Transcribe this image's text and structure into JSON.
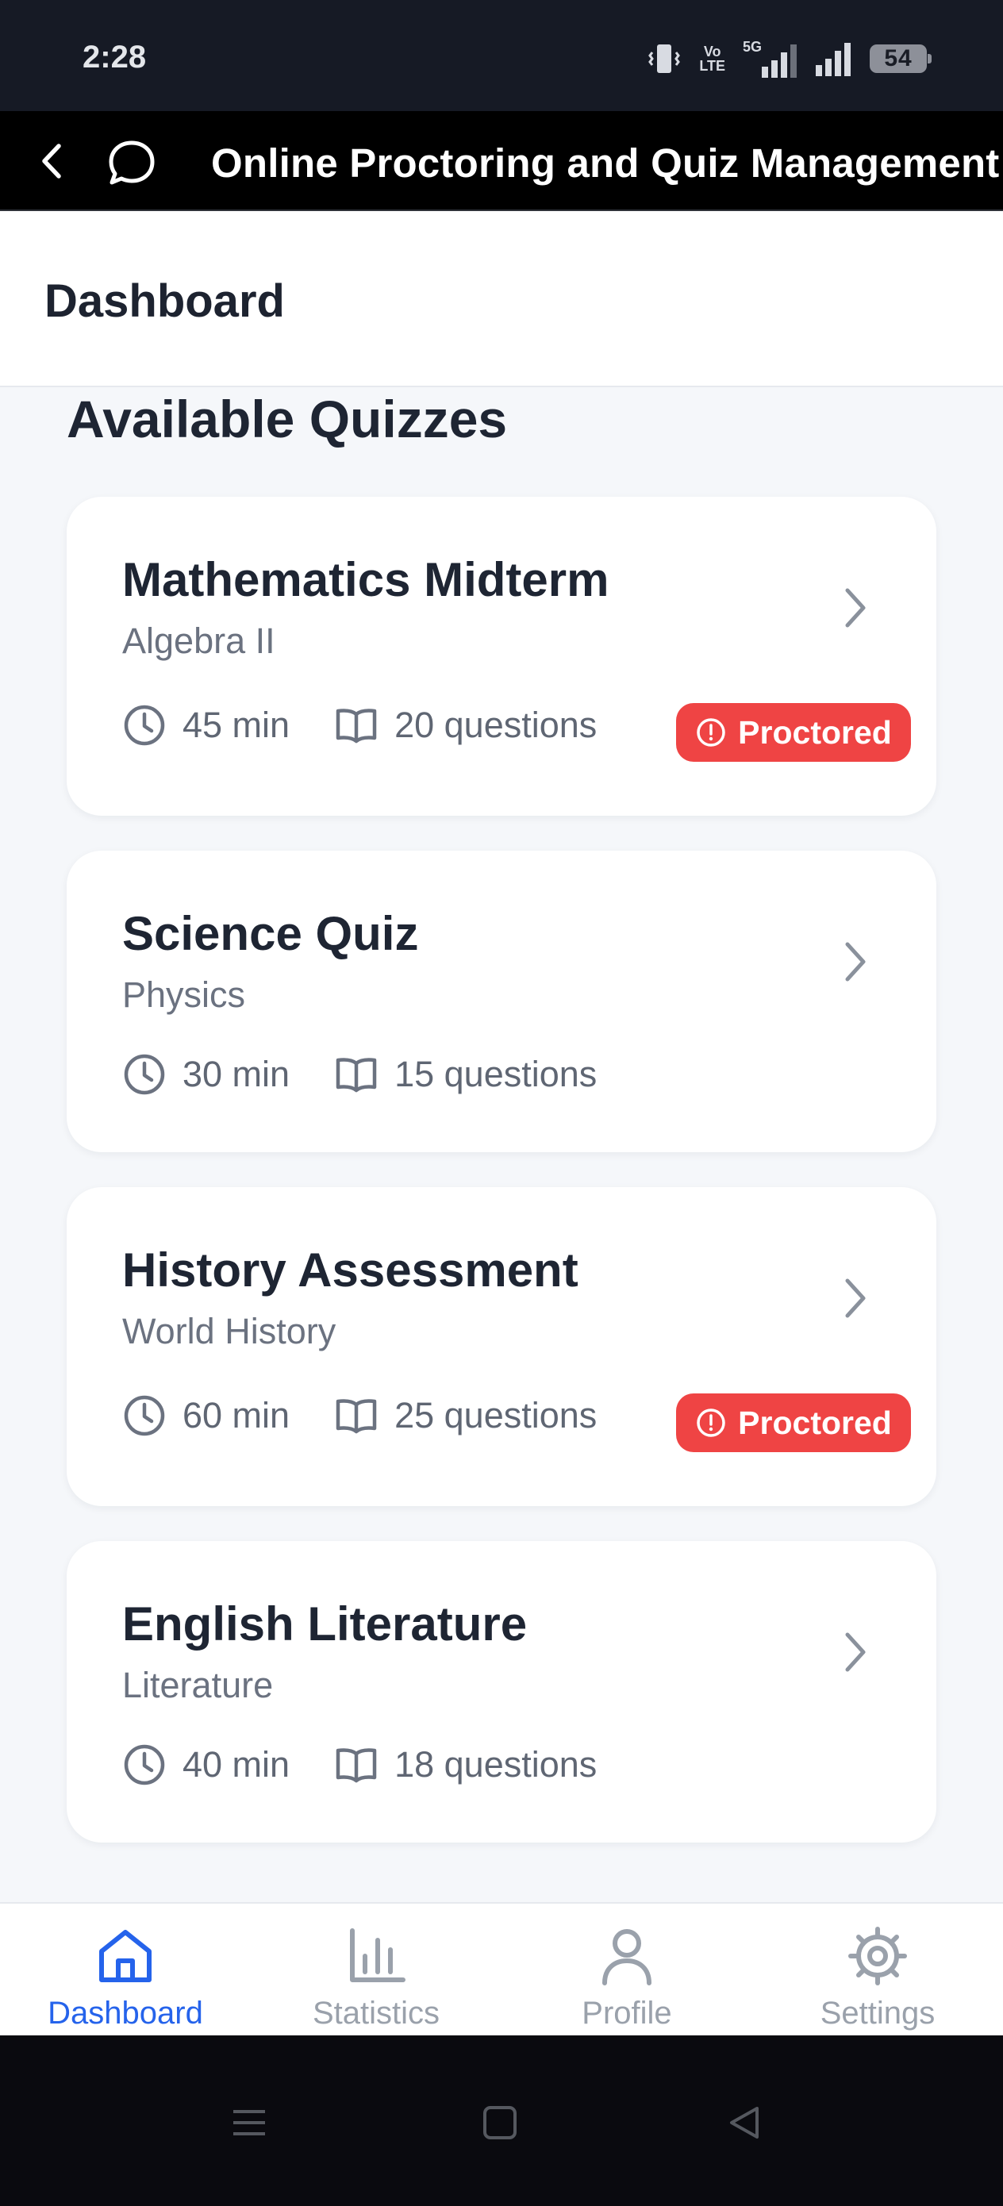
{
  "status_bar": {
    "time": "2:28",
    "network_volte_top": "Vo",
    "network_volte_bottom": "LTE",
    "network_5g": "5G",
    "battery_level": "54"
  },
  "app_header": {
    "title": "Online Proctoring and Quiz Management"
  },
  "page": {
    "title": "Dashboard",
    "section_title": "Available Quizzes"
  },
  "quizzes": [
    {
      "title": "Mathematics Midterm",
      "subject": "Algebra II",
      "duration": "45 min",
      "questions": "20 questions",
      "badge": "Proctored"
    },
    {
      "title": "Science Quiz",
      "subject": "Physics",
      "duration": "30 min",
      "questions": "15 questions"
    },
    {
      "title": "History Assessment",
      "subject": "World History",
      "duration": "60 min",
      "questions": "25 questions",
      "badge": "Proctored"
    },
    {
      "title": "English Literature",
      "subject": "Literature",
      "duration": "40 min",
      "questions": "18 questions"
    }
  ],
  "bottom_nav": {
    "items": [
      {
        "label": "Dashboard",
        "icon": "home-icon",
        "active": true
      },
      {
        "label": "Statistics",
        "icon": "bar-chart-icon",
        "active": false
      },
      {
        "label": "Profile",
        "icon": "user-icon",
        "active": false
      },
      {
        "label": "Settings",
        "icon": "gear-icon",
        "active": false
      }
    ]
  },
  "colors": {
    "accent": "#2563eb",
    "badge": "#ef4444",
    "header_bg": "#000000",
    "content_bg": "#f5f7fa"
  }
}
